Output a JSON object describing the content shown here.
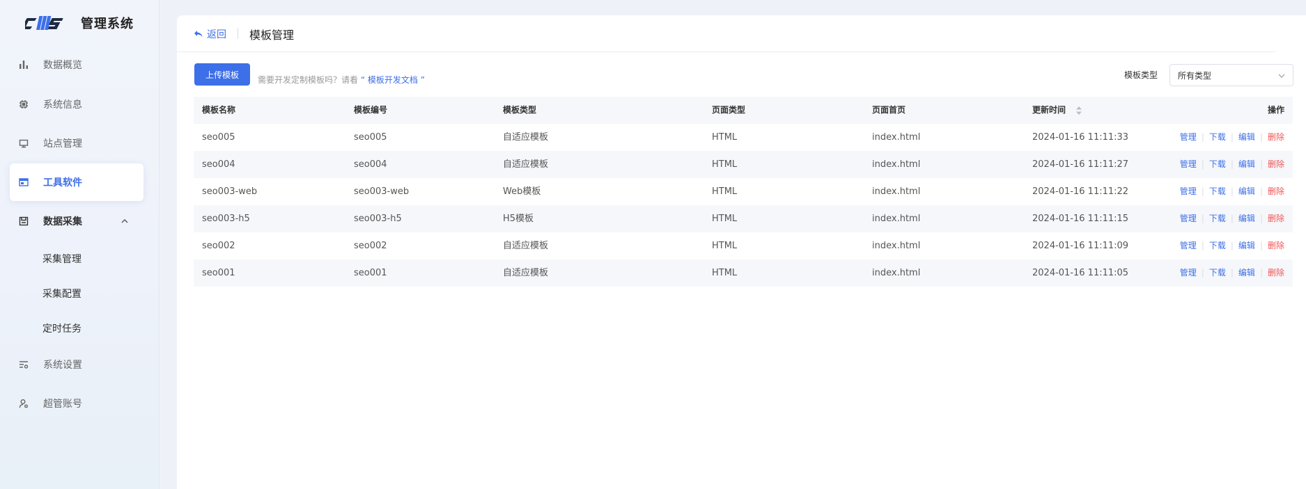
{
  "brand": {
    "logo_text": "cms",
    "title": "管理系统"
  },
  "sidebar": {
    "items": [
      {
        "label": "数据概览",
        "icon": "bar-chart-icon"
      },
      {
        "label": "系统信息",
        "icon": "chip-icon"
      },
      {
        "label": "站点管理",
        "icon": "monitor-icon"
      },
      {
        "label": "工具软件",
        "icon": "window-icon",
        "active": true
      },
      {
        "label": "数据采集",
        "icon": "save-icon",
        "expanded": true
      },
      {
        "label": "系统设置",
        "icon": "settings-list-icon"
      },
      {
        "label": "超管账号",
        "icon": "user-gear-icon"
      }
    ],
    "sub_items": [
      {
        "label": "采集管理"
      },
      {
        "label": "采集配置"
      },
      {
        "label": "定时任务"
      }
    ]
  },
  "header": {
    "back_label": "返回",
    "page_title": "模板管理"
  },
  "toolbar": {
    "upload_label": "上传模板",
    "hint_prefix": "需要开发定制模板吗？请看",
    "hint_link": "“ 模板开发文档 ”",
    "filter_label": "模板类型",
    "filter_value": "所有类型"
  },
  "table": {
    "columns": [
      "模板名称",
      "模板编号",
      "模板类型",
      "页面类型",
      "页面首页",
      "更新时间",
      "操作"
    ],
    "rows": [
      {
        "name": "seo005",
        "code": "seo005",
        "type": "自适应模板",
        "page_type": "HTML",
        "home": "index.html",
        "updated": "2024-01-16 11:11:33"
      },
      {
        "name": "seo004",
        "code": "seo004",
        "type": "自适应模板",
        "page_type": "HTML",
        "home": "index.html",
        "updated": "2024-01-16 11:11:27"
      },
      {
        "name": "seo003-web",
        "code": "seo003-web",
        "type": "Web模板",
        "page_type": "HTML",
        "home": "index.html",
        "updated": "2024-01-16 11:11:22"
      },
      {
        "name": "seo003-h5",
        "code": "seo003-h5",
        "type": "H5模板",
        "page_type": "HTML",
        "home": "index.html",
        "updated": "2024-01-16 11:11:15"
      },
      {
        "name": "seo002",
        "code": "seo002",
        "type": "自适应模板",
        "page_type": "HTML",
        "home": "index.html",
        "updated": "2024-01-16 11:11:09"
      },
      {
        "name": "seo001",
        "code": "seo001",
        "type": "自适应模板",
        "page_type": "HTML",
        "home": "index.html",
        "updated": "2024-01-16 11:11:05"
      }
    ],
    "actions": {
      "manage": "管理",
      "download": "下载",
      "edit": "编辑",
      "delete": "删除"
    }
  },
  "colors": {
    "accent": "#3d6fe8",
    "danger": "#f25656"
  }
}
